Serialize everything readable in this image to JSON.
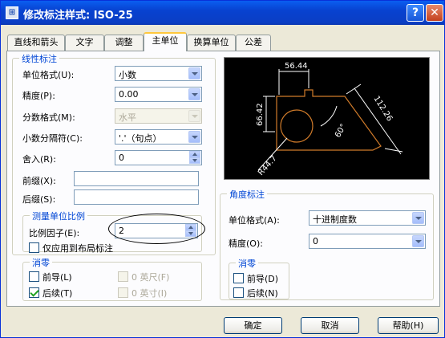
{
  "window": {
    "title": "修改标注样式: ISO-25",
    "help_icon": "?",
    "close_icon": "✕",
    "app_icon": "⊞"
  },
  "tabs": [
    "直线和箭头",
    "文字",
    "调整",
    "主单位",
    "换算单位",
    "公差"
  ],
  "active_tab": "主单位",
  "linear": {
    "title": "线性标注",
    "unit_format_label": "单位格式(U):",
    "unit_format_value": "小数",
    "precision_label": "精度(P):",
    "precision_value": "0.00",
    "fraction_label": "分数格式(M):",
    "fraction_value": "水平",
    "decimal_sep_label": "小数分隔符(C):",
    "decimal_sep_value": "'.'（句点）",
    "round_label": "舍入(R):",
    "round_value": "0",
    "prefix_label": "前缀(X):",
    "prefix_value": "",
    "suffix_label": "后缀(S):",
    "suffix_value": ""
  },
  "scale": {
    "title": "测量单位比例",
    "factor_label": "比例因子(E):",
    "factor_value": "2",
    "layout_only_label": "仅应用到布局标注",
    "layout_only_checked": false
  },
  "zero_linear": {
    "title": "消零",
    "leading_label": "前导(L)",
    "leading_checked": false,
    "trailing_label": "后续(T)",
    "trailing_checked": true,
    "feet_label": "0 英尺(F)",
    "inches_label": "0 英寸(I)"
  },
  "preview": {
    "dim_top": "56.44",
    "dim_left": "66.42",
    "dim_right": "112.26",
    "dim_radius": "R44.7",
    "dim_angle": "60°"
  },
  "angular": {
    "title": "角度标注",
    "unit_format_label": "单位格式(A):",
    "unit_format_value": "十进制度数",
    "precision_label": "精度(O):",
    "precision_value": "0"
  },
  "zero_angular": {
    "title": "消零",
    "leading_label": "前导(D)",
    "leading_checked": false,
    "trailing_label": "后续(N)",
    "trailing_checked": false
  },
  "buttons": {
    "ok": "确定",
    "cancel": "取消",
    "help": "帮助(H)"
  },
  "colors": {
    "title_bar": "#0a5ef0",
    "group_title": "#0046d5",
    "preview_bg": "#000000",
    "preview_lines": "#ffffff",
    "preview_shape": "#d07b2a"
  }
}
